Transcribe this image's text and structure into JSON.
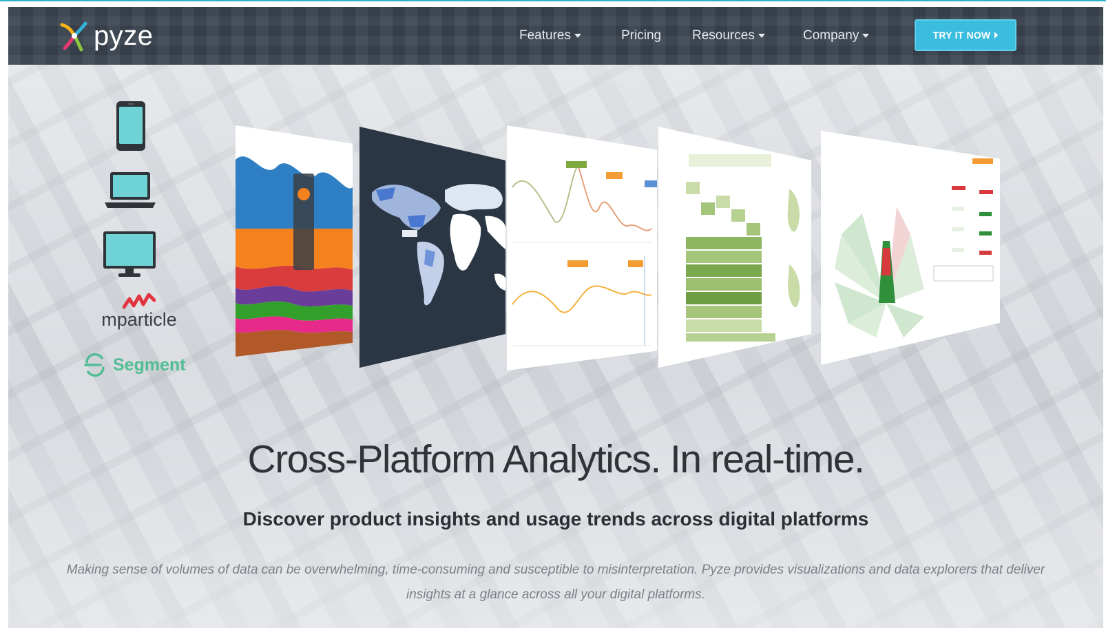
{
  "brand": {
    "name": "pyze"
  },
  "nav": {
    "items": [
      {
        "label": "Features",
        "has_dropdown": true
      },
      {
        "label": "Pricing",
        "has_dropdown": false
      },
      {
        "label": "Resources",
        "has_dropdown": true
      },
      {
        "label": "Company",
        "has_dropdown": true
      }
    ],
    "cta_label": "TRY IT NOW"
  },
  "platforms": {
    "devices": [
      "phone-icon",
      "laptop-icon",
      "monitor-icon"
    ],
    "integrations": [
      {
        "label": "mparticle",
        "color": "#e2333f"
      },
      {
        "label": "Segment",
        "color": "#52bd94"
      }
    ]
  },
  "hero": {
    "headline": "Cross-Platform Analytics. In real-time.",
    "subheadline": "Discover product insights and usage trends across digital platforms",
    "body": "Making sense of volumes of data can be overwhelming, time-consuming and susceptible to misinterpretation. Pyze provides visualizations and data explorers that deliver insights at a glance across all your digital platforms."
  },
  "colors": {
    "nav_bg": "#3a4450",
    "cta_bg": "#3bbde0",
    "accent": "#30b3c9",
    "headline": "#2f3338"
  }
}
